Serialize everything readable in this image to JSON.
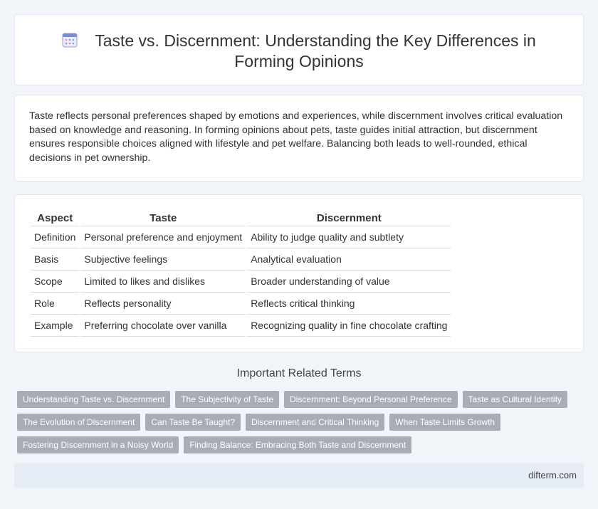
{
  "header": {
    "title": "Taste vs. Discernment: Understanding the Key Differences in Forming Opinions",
    "icon": "calendar-icon"
  },
  "intro": {
    "text": "Taste reflects personal preferences shaped by emotions and experiences, while discernment involves critical evaluation based on knowledge and reasoning. In forming opinions about pets, taste guides initial attraction, but discernment ensures responsible choices aligned with lifestyle and pet welfare. Balancing both leads to well-rounded, ethical decisions in pet ownership."
  },
  "table": {
    "headers": [
      "Aspect",
      "Taste",
      "Discernment"
    ],
    "rows": [
      [
        "Definition",
        "Personal preference and enjoyment",
        "Ability to judge quality and subtlety"
      ],
      [
        "Basis",
        "Subjective feelings",
        "Analytical evaluation"
      ],
      [
        "Scope",
        "Limited to likes and dislikes",
        "Broader understanding of value"
      ],
      [
        "Role",
        "Reflects personality",
        "Reflects critical thinking"
      ],
      [
        "Example",
        "Preferring chocolate over vanilla",
        "Recognizing quality in fine chocolate crafting"
      ]
    ]
  },
  "related": {
    "title": "Important Related Terms",
    "tags": [
      "Understanding Taste vs. Discernment",
      "The Subjectivity of Taste",
      "Discernment: Beyond Personal Preference",
      "Taste as Cultural Identity",
      "The Evolution of Discernment",
      "Can Taste Be Taught?",
      "Discernment and Critical Thinking",
      "When Taste Limits Growth",
      "Fostering Discernment in a Noisy World",
      "Finding Balance: Embracing Both Taste and Discernment"
    ]
  },
  "footer": {
    "site": "difterm.com"
  },
  "colors": {
    "background": "#f1f4f8",
    "tag": "#a8adb5",
    "footer": "#e6ecf5",
    "icon_accent": "#7b8bd4"
  }
}
